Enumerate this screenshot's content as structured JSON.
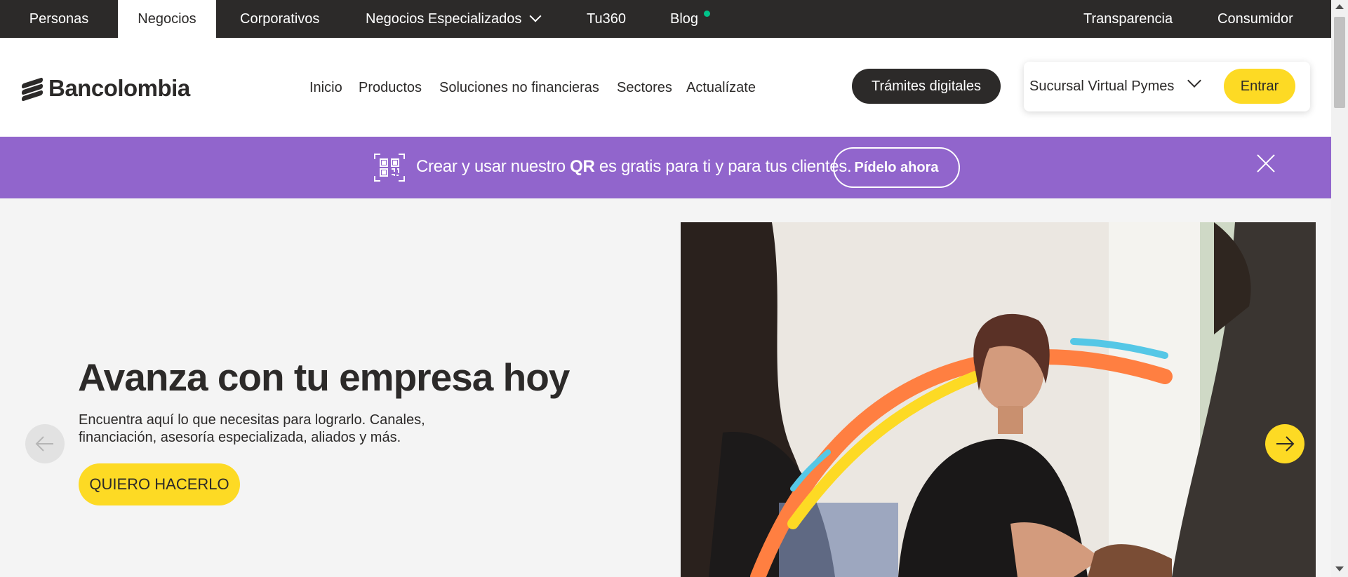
{
  "topbar": {
    "items": [
      {
        "label": "Personas"
      },
      {
        "label": "Negocios"
      },
      {
        "label": "Corporativos"
      },
      {
        "label": "Negocios Especializados"
      },
      {
        "label": "Tu360"
      },
      {
        "label": "Blog"
      },
      {
        "label": "Transparencia"
      },
      {
        "label": "Consumidor"
      }
    ],
    "active": "Negocios"
  },
  "header": {
    "logo_text": "Bancolombia",
    "nav": [
      "Inicio",
      "Productos",
      "Soluciones no financieras",
      "Sectores",
      "Actualízate"
    ],
    "tramites_button": "Trámites digitales",
    "login": {
      "selector_label": "Sucursal Virtual Pymes",
      "enter_button": "Entrar"
    }
  },
  "banner": {
    "text_before": "Crear y usar nuestro ",
    "text_bold": "QR",
    "text_after": " es gratis para ti y para tus clientes.",
    "button": "Pídelo ahora"
  },
  "hero": {
    "title": "Avanza con tu empresa hoy",
    "description": "Encuentra aquí lo que necesitas para lograrlo. Canales, financiación, asesoría especializada, aliados y más.",
    "cta": "QUIERO HACERLO"
  },
  "colors": {
    "dark": "#2c2a29",
    "yellow": "#fdda24",
    "purple": "#9165cc",
    "notification_dot": "#00c389"
  }
}
